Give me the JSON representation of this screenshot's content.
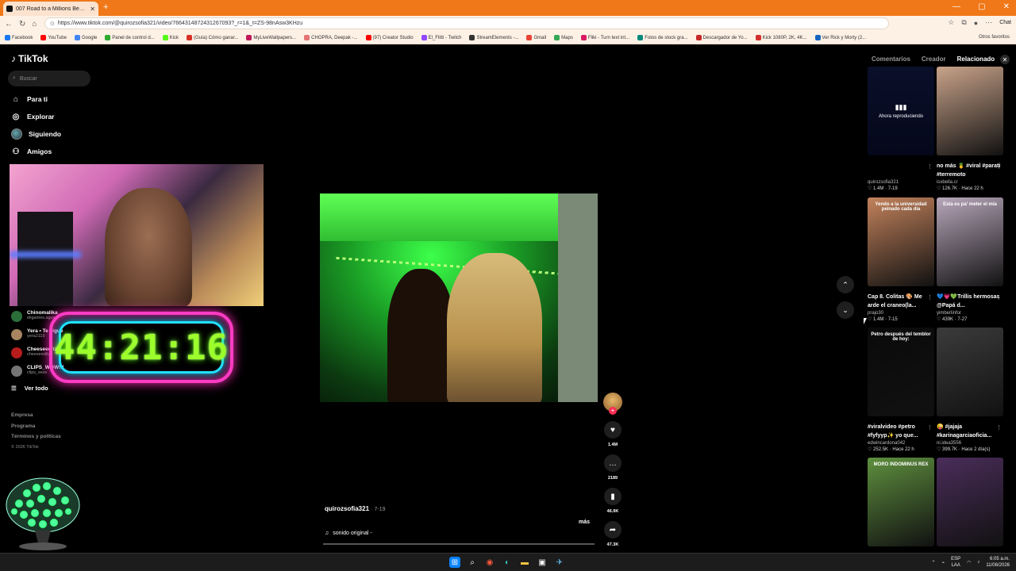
{
  "browser": {
    "tab_title": "007 Road to a Millions Behind...",
    "url": "https://www.tiktok.com/@quirozsofia321/video/7664314872431267093?_r=1&_t=ZS-98nAsw3KHzu",
    "chat_label": "Chat",
    "bookmarks": [
      {
        "label": "Facebook",
        "color": "#1877f2"
      },
      {
        "label": "YouTube",
        "color": "#ff0000"
      },
      {
        "label": "Google",
        "color": "#4285f4"
      },
      {
        "label": "Panel de control d...",
        "color": "#2eaa2e"
      },
      {
        "label": "Kick",
        "color": "#53fc18"
      },
      {
        "label": "(Guía) Cómo ganar...",
        "color": "#d93025"
      },
      {
        "label": "MyLiveWallpapers...",
        "color": "#c2185b"
      },
      {
        "label": "CHOPRA, Deepak -...",
        "color": "#e57373"
      },
      {
        "label": "(97) Creator Studio",
        "color": "#ff0000"
      },
      {
        "label": "El_Flitti - Twitch",
        "color": "#9146ff"
      },
      {
        "label": "StreamElements -...",
        "color": "#333333"
      },
      {
        "label": "Gmail",
        "color": "#ea4335"
      },
      {
        "label": "Maps",
        "color": "#34a853"
      },
      {
        "label": "Fliki - Turn text int...",
        "color": "#d81b60"
      },
      {
        "label": "Fotos de stock gra...",
        "color": "#00897b"
      },
      {
        "label": "Descargador de Yo...",
        "color": "#c62828"
      },
      {
        "label": "Kick 1080P, 2K, 4K...",
        "color": "#d32f2f"
      },
      {
        "label": "Ver Rick y Morty (2...",
        "color": "#1565c0"
      }
    ],
    "other_favorites": "Otros favoritos"
  },
  "sidebar": {
    "logo": "TikTok",
    "search_placeholder": "Buscar",
    "nav": [
      {
        "label": "Para ti",
        "icon": "home-icon"
      },
      {
        "label": "Explorar",
        "icon": "compass-icon"
      },
      {
        "label": "Siguiendo",
        "icon": "following-avatar"
      },
      {
        "label": "Amigos",
        "icon": "friends-icon"
      }
    ],
    "following": [
      {
        "name": "Chinomalika",
        "sub": "eligames.agua",
        "color": "#2b6e3a"
      },
      {
        "name": "Yera • Te sigue",
        "sub": "yera2119",
        "color": "#a88460"
      },
      {
        "name": "Cheeseeditz",
        "sub": "cheeseeditz",
        "color": "#b71c1c"
      },
      {
        "name": "CLIPS_WOW!!!",
        "sub": "clips_wow",
        "color": "#757575"
      }
    ],
    "see_all": "Ver todo",
    "footer": [
      "Empresa",
      "Programa",
      "Términos y políticas"
    ],
    "copyright": "© 2026 TikTok"
  },
  "overlay": {
    "timer": "44:21:16"
  },
  "video": {
    "author": "quirozsofia321",
    "date": "7-19",
    "more": "más",
    "sound": "sonido original -",
    "likes": "1.4M",
    "comments": "2189",
    "saves": "46.9K",
    "shares": "47.3K"
  },
  "related": {
    "tabs": [
      "Comentarios",
      "Creador",
      "Relacionado"
    ],
    "active_tab": "Relacionado",
    "now_playing": "Ahora reproduciendo",
    "cards": [
      {
        "title": "",
        "user": "quirozsofia321",
        "meta": "♡ 1.4M · 7-19",
        "thumb": "nowplaying",
        "overlay": ""
      },
      {
        "title": "no más 🍍 #viral #parati #terremoto",
        "user": "isxbella.cr",
        "meta": "♡ 126.7K · Hace 22 h",
        "thumb": "#c9a38a",
        "overlay": ""
      },
      {
        "title": "Cap 8. Colitas 🎨 Me arde el craneo(la...",
        "user": "prajo30",
        "meta": "♡ 1.4M · 7-15",
        "thumb": "#c3825c",
        "overlay": "Yendo a la universidad peinado cada día"
      },
      {
        "title": "💙💗💚Trillis hermosas @Papá d...",
        "user": "yimberlinfor",
        "meta": "♡ 439K · 7-27",
        "thumb": "#b8a7bb",
        "overlay": "Esta es pa' meter el mía"
      },
      {
        "title": "#viralvideo #petro #fyfyyp✨ yo que...",
        "user": "edwincardona042",
        "meta": "♡ 252.5K · Hace 22 h",
        "thumb": "#0a0a0a",
        "overlay": "Petro después del temblor de hoy:"
      },
      {
        "title": "😜 #jajaja #karinagarciaoficia...",
        "user": "ni.idea3556",
        "meta": "♡ 399.7K · Hace 2 día(s)",
        "thumb": "#3b3b3b",
        "overlay": ""
      },
      {
        "title": "",
        "user": "",
        "meta": "",
        "thumb": "#5e8f3e",
        "overlay": "MORO INDOMINUS REX"
      },
      {
        "title": "",
        "user": "",
        "meta": "",
        "thumb": "#4a2d5a",
        "overlay": ""
      }
    ]
  },
  "taskbar": {
    "lang": "ESP",
    "lang2": "LAA",
    "time": "6:05 a.m.",
    "date": "11/08/2026"
  }
}
